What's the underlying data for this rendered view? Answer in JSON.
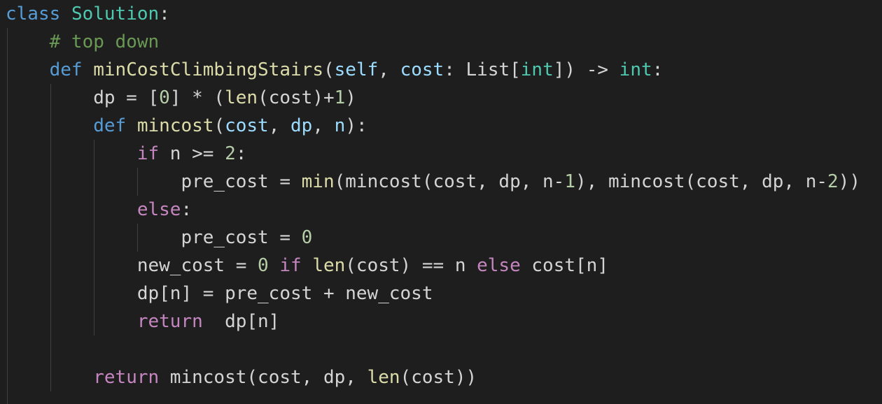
{
  "editor": {
    "language": "python",
    "lines": [
      [
        {
          "t": "class",
          "c": "kw-blue"
        },
        {
          "t": " "
        },
        {
          "t": "Solution",
          "c": "cls"
        },
        {
          "t": ":"
        }
      ],
      [
        {
          "t": "    "
        },
        {
          "t": "# top down",
          "c": "cmt"
        }
      ],
      [
        {
          "t": "    "
        },
        {
          "t": "def",
          "c": "kw-blue"
        },
        {
          "t": " "
        },
        {
          "t": "minCostClimbingStairs",
          "c": "fn"
        },
        {
          "t": "("
        },
        {
          "t": "self",
          "c": "param"
        },
        {
          "t": ", "
        },
        {
          "t": "cost",
          "c": "param"
        },
        {
          "t": ": List["
        },
        {
          "t": "int",
          "c": "cls"
        },
        {
          "t": "]) -> "
        },
        {
          "t": "int",
          "c": "cls"
        },
        {
          "t": ":"
        }
      ],
      [
        {
          "t": "        dp = ["
        },
        {
          "t": "0",
          "c": "num"
        },
        {
          "t": "] * ("
        },
        {
          "t": "len",
          "c": "fn"
        },
        {
          "t": "(cost)+"
        },
        {
          "t": "1",
          "c": "num"
        },
        {
          "t": ")"
        }
      ],
      [
        {
          "t": "        "
        },
        {
          "t": "def",
          "c": "kw-blue"
        },
        {
          "t": " "
        },
        {
          "t": "mincost",
          "c": "fn"
        },
        {
          "t": "("
        },
        {
          "t": "cost",
          "c": "param"
        },
        {
          "t": ", "
        },
        {
          "t": "dp",
          "c": "param"
        },
        {
          "t": ", "
        },
        {
          "t": "n",
          "c": "param"
        },
        {
          "t": "):"
        }
      ],
      [
        {
          "t": "            "
        },
        {
          "t": "if",
          "c": "kw-purple"
        },
        {
          "t": " n >= "
        },
        {
          "t": "2",
          "c": "num"
        },
        {
          "t": ":"
        }
      ],
      [
        {
          "t": "                pre_cost = "
        },
        {
          "t": "min",
          "c": "fn"
        },
        {
          "t": "(mincost(cost, dp, n-"
        },
        {
          "t": "1",
          "c": "num"
        },
        {
          "t": "), mincost(cost, dp, n-"
        },
        {
          "t": "2",
          "c": "num"
        },
        {
          "t": "))"
        }
      ],
      [
        {
          "t": "            "
        },
        {
          "t": "else",
          "c": "kw-purple"
        },
        {
          "t": ":"
        }
      ],
      [
        {
          "t": "                pre_cost = "
        },
        {
          "t": "0",
          "c": "num"
        }
      ],
      [
        {
          "t": "            new_cost = "
        },
        {
          "t": "0",
          "c": "num"
        },
        {
          "t": " "
        },
        {
          "t": "if",
          "c": "kw-purple"
        },
        {
          "t": " "
        },
        {
          "t": "len",
          "c": "fn"
        },
        {
          "t": "(cost) == n "
        },
        {
          "t": "else",
          "c": "kw-purple"
        },
        {
          "t": " cost[n]"
        }
      ],
      [
        {
          "t": "            dp[n] = pre_cost + new_cost"
        }
      ],
      [
        {
          "t": "            "
        },
        {
          "t": "return",
          "c": "kw-purple"
        },
        {
          "t": "  dp[n]"
        }
      ],
      [],
      [
        {
          "t": "        "
        },
        {
          "t": "return",
          "c": "kw-purple"
        },
        {
          "t": " mincost(cost, dp, "
        },
        {
          "t": "len",
          "c": "fn"
        },
        {
          "t": "(cost))"
        }
      ]
    ]
  }
}
